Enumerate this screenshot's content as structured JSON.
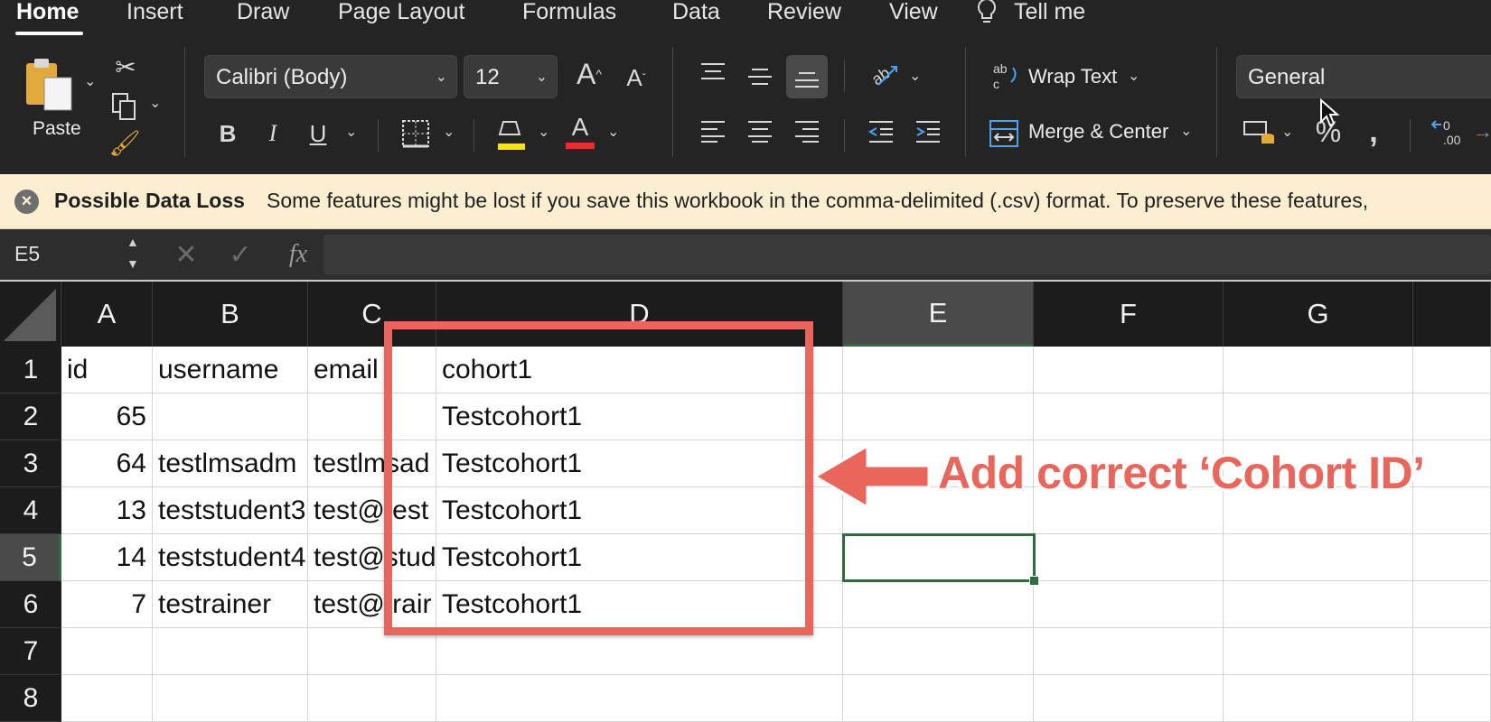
{
  "ribbon": {
    "tabs": [
      "Home",
      "Insert",
      "Draw",
      "Page Layout",
      "Formulas",
      "Data",
      "Review",
      "View",
      "Tell me"
    ],
    "paste_label": "Paste",
    "font_name": "Calibri (Body)",
    "font_size": "12",
    "wrap_text_label": "Wrap Text",
    "merge_center_label": "Merge & Center",
    "number_format": "General",
    "bold_glyph": "B",
    "italic_glyph": "I",
    "underline_glyph": "U",
    "font_color_glyph": "A",
    "highlight_color": "#f5e600",
    "font_color": "#e03030"
  },
  "message_bar": {
    "title": "Possible Data Loss",
    "text": "Some features might be lost if you save this workbook in the comma-delimited (.csv) format. To preserve these features,"
  },
  "formula_bar": {
    "name_box": "E5",
    "fx_label": "fx",
    "formula": ""
  },
  "sheet": {
    "columns": [
      "A",
      "B",
      "C",
      "D",
      "E",
      "F",
      "G"
    ],
    "rows": [
      "1",
      "2",
      "3",
      "4",
      "5",
      "6",
      "7",
      "8"
    ],
    "selected_cell": "E5",
    "cells": [
      [
        "id",
        "username",
        "email",
        "cohort1"
      ],
      [
        "65",
        "",
        "",
        "Testcohort1"
      ],
      [
        "64",
        "testlmsadm",
        "testlmsad",
        "Testcohort1"
      ],
      [
        "13",
        "teststudent3",
        "test@test",
        "Testcohort1"
      ],
      [
        "14",
        "teststudent4",
        "test@stud",
        "Testcohort1"
      ],
      [
        "7",
        "testrainer",
        "test@trair",
        "Testcohort1"
      ],
      [
        "",
        "",
        "",
        ""
      ]
    ]
  },
  "annotation": {
    "text": "Add correct ‘Cohort ID’",
    "color": "#e9665c"
  }
}
